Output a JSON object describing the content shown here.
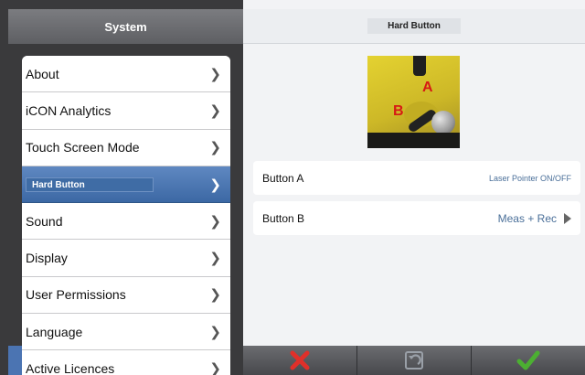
{
  "left": {
    "title": "System",
    "menu": [
      {
        "label": "About"
      },
      {
        "label": "iCON Analytics"
      },
      {
        "label": "Touch Screen Mode"
      },
      {
        "label": "Hard Button"
      },
      {
        "label": "Sound"
      },
      {
        "label": "Display"
      },
      {
        "label": "User Permissions"
      },
      {
        "label": "Language"
      },
      {
        "label": "Active Licences"
      }
    ],
    "selected_index": 3
  },
  "right": {
    "title": "Hard Button",
    "image": {
      "letter_a": "A",
      "letter_b": "B"
    },
    "options": [
      {
        "label": "Button A",
        "value": "Laser Pointer ON/OFF"
      },
      {
        "label": "Button B",
        "value": "Meas + Rec"
      }
    ]
  },
  "toolbar": {
    "icons": [
      "cancel-icon",
      "undo-icon",
      "confirm-icon"
    ]
  },
  "colors": {
    "selected_blue": "#4a75b0",
    "cancel_red": "#e0302a",
    "confirm_green": "#4caf32"
  }
}
